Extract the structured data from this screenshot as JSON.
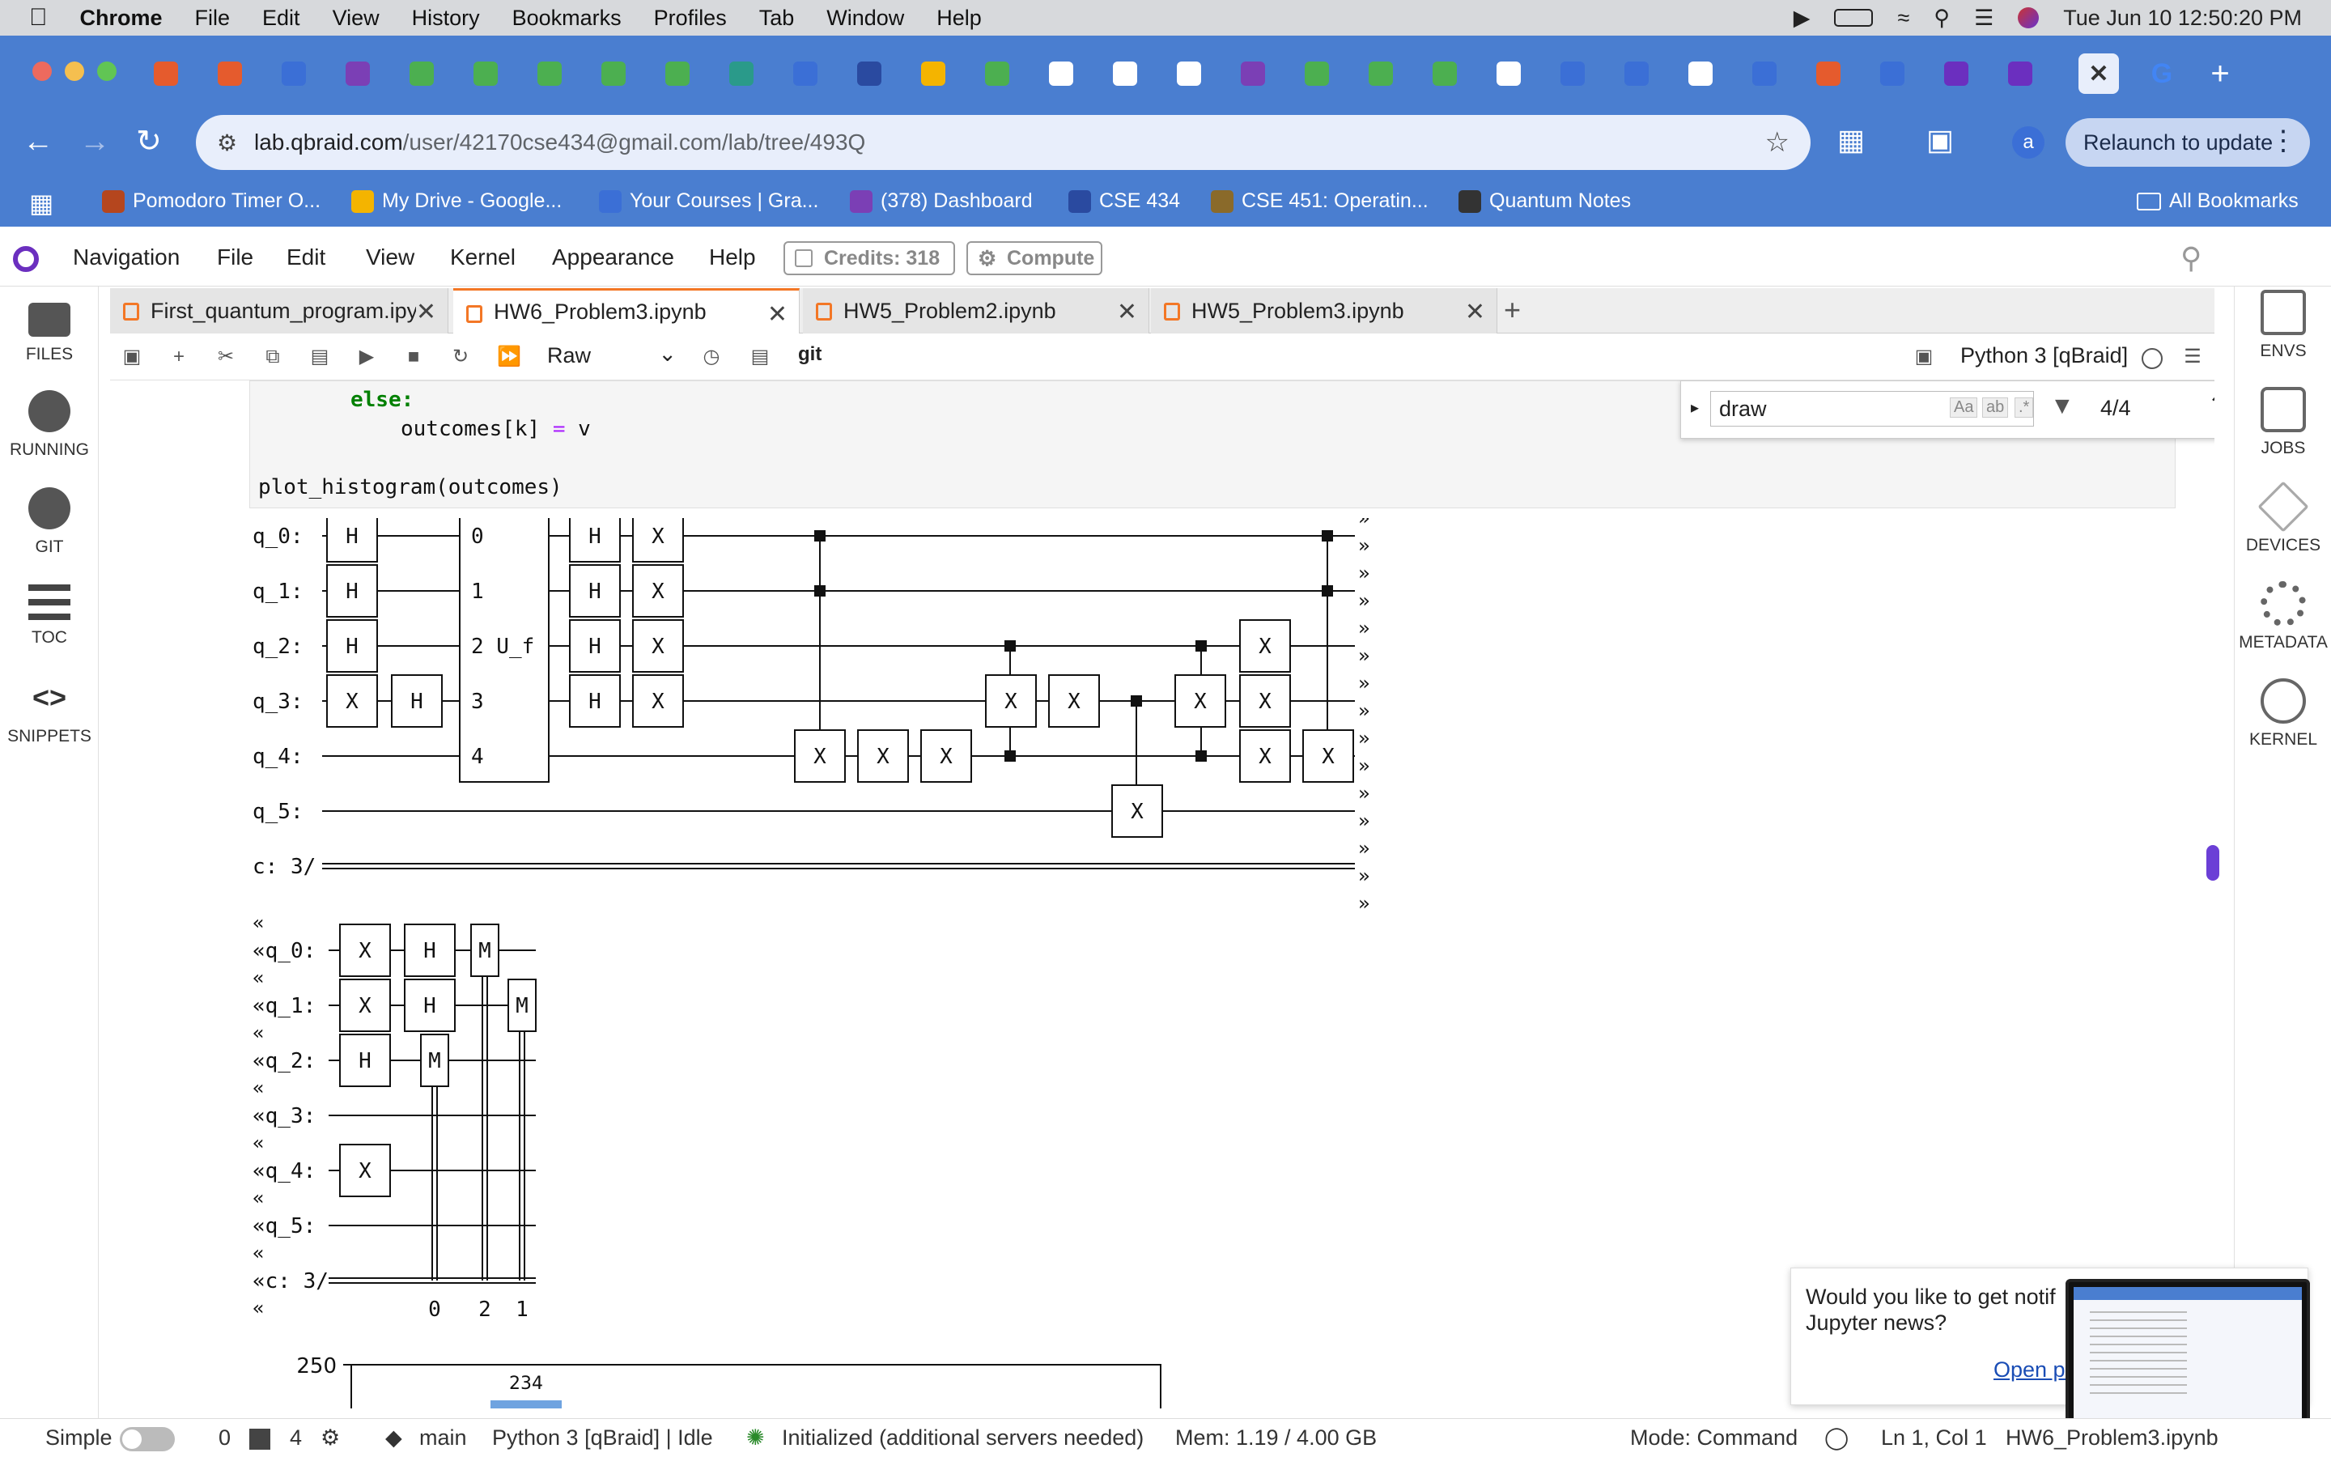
{
  "macos_menubar": {
    "app": "Chrome",
    "items": [
      "File",
      "Edit",
      "View",
      "History",
      "Bookmarks",
      "Profiles",
      "Tab",
      "Window",
      "Help"
    ],
    "clock": "Tue Jun 10  12:50:20 PM"
  },
  "browser": {
    "url_host": "lab.qbraid.com",
    "url_path": "/user/42170cse434@gmail.com/lab/tree/493Q",
    "profile_initial": "a",
    "relaunch_label": "Relaunch to update",
    "bookmarks": [
      {
        "label": "Pomodoro Timer O...",
        "color": "#b5461e"
      },
      {
        "label": "My Drive - Google...",
        "color": "#f4b400"
      },
      {
        "label": "Your Courses | Gra...",
        "color": "#3b6fd6"
      },
      {
        "label": "(378) Dashboard",
        "color": "#7b3fb5"
      },
      {
        "label": "CSE 434",
        "color": "#2a4aa0"
      },
      {
        "label": "CSE 451: Operatin...",
        "color": "#8a6a2a"
      },
      {
        "label": "Quantum Notes",
        "color": "#333333"
      }
    ],
    "all_bookmarks_label": "All Bookmarks"
  },
  "jupyter_menu": {
    "items": [
      "Navigation",
      "File",
      "Edit",
      "View",
      "Kernel",
      "Appearance",
      "Help"
    ],
    "credits_label": "Credits:  318",
    "compute_label": "Compute"
  },
  "left_sidebar": [
    {
      "label": "FILES",
      "icon": "folder-icon"
    },
    {
      "label": "RUNNING",
      "icon": "stop-circle-icon"
    },
    {
      "label": "GIT",
      "icon": "github-icon"
    },
    {
      "label": "TOC",
      "icon": "list-icon"
    },
    {
      "label": "SNIPPETS",
      "icon": "code-brackets-icon"
    }
  ],
  "right_sidebar": [
    {
      "label": "ENVS",
      "icon": "network-icon"
    },
    {
      "label": "JOBS",
      "icon": "chip-icon"
    },
    {
      "label": "DEVICES",
      "icon": "cube-icon"
    },
    {
      "label": "METADATA",
      "icon": "gears-icon"
    },
    {
      "label": "KERNEL",
      "icon": "gauge-icon"
    }
  ],
  "doc_tabs": [
    {
      "label": "First_quantum_program.ipy",
      "active": false
    },
    {
      "label": "HW6_Problem3.ipynb",
      "active": true
    },
    {
      "label": "HW5_Problem2.ipynb",
      "active": false
    },
    {
      "label": "HW5_Problem3.ipynb",
      "active": false
    }
  ],
  "notebook_toolbar": {
    "cell_type": "Raw",
    "git_label": "git",
    "kernel_label": "Python 3 [qBraid]"
  },
  "find": {
    "query": "draw",
    "case_label": "Aa",
    "word_label": "ab",
    "regex_label": ".*",
    "count": "4/4"
  },
  "code_lines": {
    "else_kw": "else:",
    "assign_name": "outcomes",
    "assign_index": "k",
    "assign_op": "=",
    "assign_value": "v",
    "plot_call": "plot_histogram(outcomes)"
  },
  "circuit": {
    "part1_labels": [
      "q_0:",
      "q_1:",
      "q_2:",
      "q_3:",
      "q_4:",
      "q_5:",
      "c: 3/"
    ],
    "part2_labels": [
      "«q_0:",
      "«q_1:",
      "«q_2:",
      "«q_3:",
      "«q_4:",
      "«q_5:",
      "«c: 3/"
    ],
    "uf_labels": [
      "0",
      "1",
      "2  U_f",
      "3",
      "4"
    ],
    "measure_indices": [
      "0",
      "2",
      "1"
    ],
    "continuation": "»",
    "continuation_left": "«"
  },
  "histogram": {
    "y_tick_top": "250",
    "bar_label": "234"
  },
  "notification": {
    "text_line1": "Would you like to get notif",
    "text_line2": "Jupyter news?",
    "link": "Open pr"
  },
  "status_bar": {
    "mode_simple": "Simple",
    "terminals": "0",
    "kernels": "4",
    "branch": "main",
    "kernel_status": "Python 3 [qBraid] | Idle",
    "lsp": "Initialized (additional servers needed)",
    "memory": "Mem: 1.19 / 4.00 GB",
    "mode": "Mode: Command",
    "position": "Ln 1, Col 1",
    "filename": "HW6_Problem3.ipynb"
  }
}
